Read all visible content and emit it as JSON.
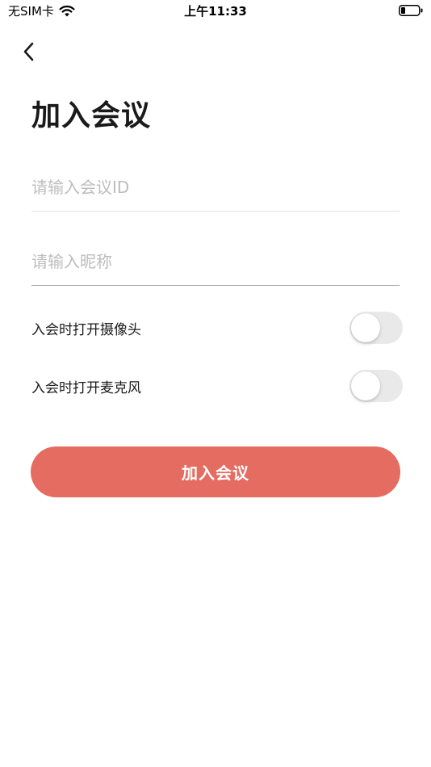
{
  "status_bar": {
    "carrier": "无SIM卡",
    "time": "上午11:33",
    "wifi_icon": "wifi-icon",
    "battery_icon": "battery-icon"
  },
  "nav": {
    "back_icon": "chevron-left-icon"
  },
  "page": {
    "title": "加入会议"
  },
  "form": {
    "meeting_id": {
      "value": "",
      "placeholder": "请输入会议ID"
    },
    "nickname": {
      "value": "",
      "placeholder": "请输入昵称"
    },
    "options": [
      {
        "label": "入会时打开摄像头",
        "enabled": false
      },
      {
        "label": "入会时打开麦克风",
        "enabled": false
      }
    ],
    "join_label": "加入会议"
  },
  "colors": {
    "primary": "#e46c61",
    "toggle_off": "#e9e9ea",
    "placeholder": "#bdbdbd"
  }
}
